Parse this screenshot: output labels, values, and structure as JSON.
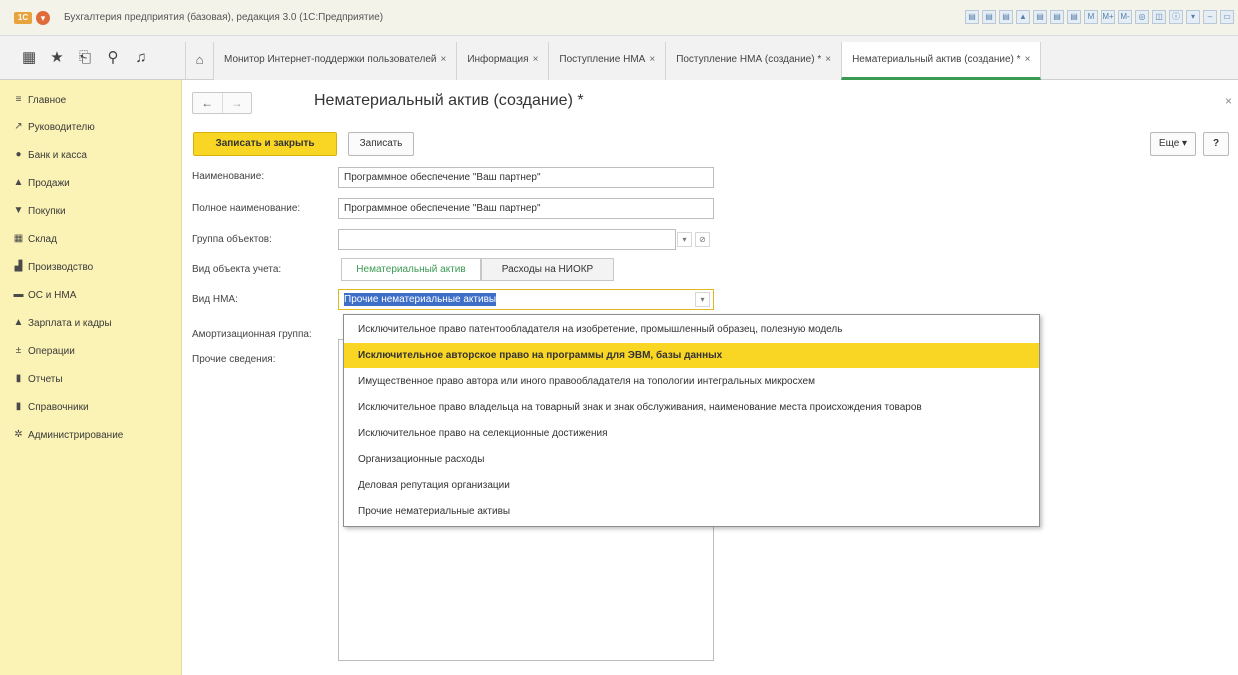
{
  "window": {
    "logo_text": "1С",
    "title": "Бухгалтерия предприятия (базовая), редакция 3.0 (1С:Предприятие)",
    "tool_glyphs": [
      "▤",
      "▤",
      "▤",
      "▲",
      "▤",
      "▤",
      "▤",
      "M",
      "M+",
      "M-",
      "◎",
      "◫",
      "ⓘ",
      "▾",
      "–",
      "▭"
    ]
  },
  "nav": {
    "icons": [
      "grid-icon",
      "star-icon",
      "history-icon",
      "search-icon",
      "bell-icon"
    ],
    "tabs": [
      {
        "label": "Монитор Интернет-поддержки пользователей",
        "close": "×"
      },
      {
        "label": "Информация",
        "close": "×"
      },
      {
        "label": "Поступление НМА",
        "close": "×"
      },
      {
        "label": "Поступление НМА (создание) *",
        "close": "×"
      },
      {
        "label": "Нематериальный актив (создание) *",
        "close": "×"
      }
    ]
  },
  "sidebar": {
    "items": [
      {
        "label": "Главное",
        "icon": "≡"
      },
      {
        "label": "Руководителю",
        "icon": "↗"
      },
      {
        "label": "Банк и касса",
        "icon": "●"
      },
      {
        "label": "Продажи",
        "icon": "▲"
      },
      {
        "label": "Покупки",
        "icon": "▼"
      },
      {
        "label": "Склад",
        "icon": "▦"
      },
      {
        "label": "Производство",
        "icon": "▟"
      },
      {
        "label": "ОС и НМА",
        "icon": "▬"
      },
      {
        "label": "Зарплата и кадры",
        "icon": "▲"
      },
      {
        "label": "Операции",
        "icon": "±"
      },
      {
        "label": "Отчеты",
        "icon": "▮"
      },
      {
        "label": "Справочники",
        "icon": "▮"
      },
      {
        "label": "Администрирование",
        "icon": "✲"
      }
    ]
  },
  "form": {
    "back": "←",
    "forward": "→",
    "title": "Нематериальный актив (создание) *",
    "close": "×",
    "save_close_label": "Записать и закрыть",
    "save_label": "Записать",
    "more_label": "Еще ▾",
    "help_label": "?",
    "fields": {
      "name_label": "Наименование:",
      "name_value": "Программное обеспечение \"Ваш партнер\"",
      "fullname_label": "Полное наименование:",
      "fullname_value": "Программное обеспечение \"Ваш партнер\"",
      "group_label": "Группа объектов:",
      "group_value": "",
      "account_type_label": "Вид объекта учета:",
      "account_type_option1": "Нематериальный актив",
      "account_type_option2": "Расходы на НИОКР",
      "nma_type_label": "Вид НМА:",
      "nma_type_value": "Прочие нематериальные активы",
      "amort_label": "Амортизационная группа:",
      "other_label": "Прочие сведения:"
    },
    "dropdown_glyph": "▾",
    "open_glyph": "⊘"
  },
  "dropdown": {
    "items": [
      "Исключительное право патентообладателя на изобретение, промышленный образец, полезную модель",
      "Исключительное авторское право на программы для ЭВМ, базы данных",
      "Имущественное право автора или иного правообладателя на топологии интегральных микросхем",
      "Исключительное право владельца на товарный знак и знак обслуживания, наименование места происхождения товаров",
      "Исключительное право на селекционные достижения",
      "Организационные расходы",
      "Деловая репутация организации",
      "Прочие нематериальные активы"
    ],
    "highlighted_index": 1
  },
  "colors": {
    "sidebar_bg": "#fbf3b5",
    "primary_button": "#fad624",
    "active_tab_accent": "#3a9a52",
    "selection": "#3d6fc9"
  }
}
